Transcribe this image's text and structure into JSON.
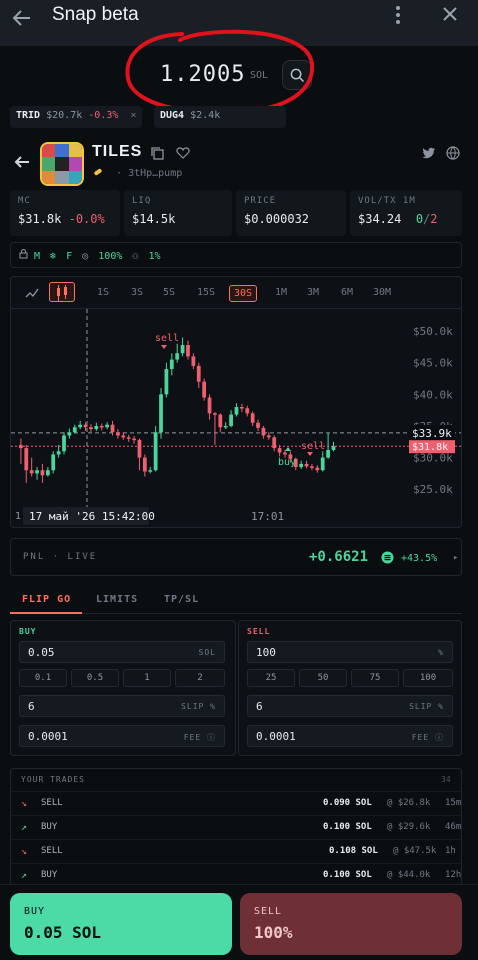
{
  "app": {
    "title": "Snap beta",
    "icons": [
      "back-arrow-icon",
      "kebab-menu-icon",
      "close-icon"
    ]
  },
  "balance": {
    "value": "1.2005",
    "unit": "SOL"
  },
  "ticker_chips": [
    {
      "symbol": "TRID",
      "mc": "$20.7k",
      "change": "-0.3%",
      "close": "×"
    },
    {
      "symbol": "DUG4",
      "mc": "$2.4k",
      "change": "",
      "close": ""
    }
  ],
  "token": {
    "name": "TILES",
    "address": "3tHp…pump",
    "separator": "·"
  },
  "stats": {
    "mc": {
      "label": "MC",
      "value": "$31.8k",
      "change": "-0.0%"
    },
    "liq": {
      "label": "LIQ",
      "value": "$14.5k"
    },
    "price": {
      "label": "PRICE",
      "value": "$0.000032"
    },
    "vol": {
      "label": "VOL/TX 1M",
      "value": "$34.24",
      "buys": "0",
      "slash": "/",
      "sells": "2"
    }
  },
  "flags": {
    "m": "M",
    "f": "F",
    "pct1": "100%",
    "pct2": "1%"
  },
  "chart": {
    "timeframes": [
      "1S",
      "3S",
      "5S",
      "15S",
      "30S",
      "1M",
      "3M",
      "6M",
      "30M"
    ],
    "active_timeframe": "30S",
    "crosshair_date": "17 май '26",
    "crosshair_time": "15:42:00",
    "axis_start_label": "1",
    "time_label": "17:01",
    "markers": {
      "sell1": "sell",
      "sell2": "sell",
      "buy": "buy"
    },
    "price_tags": {
      "high": "$33.9k",
      "current": "$31.8k"
    }
  },
  "chart_data": {
    "type": "candlestick",
    "yticks": [
      "$50.0k",
      "$45.0k",
      "$40.0k",
      "$35.0k",
      "$30.0k",
      "$25.0k"
    ],
    "ytick_values": [
      50.0,
      45.0,
      40.0,
      35.0,
      30.0,
      25.0
    ],
    "ylim": [
      22.5,
      53.5
    ],
    "reference_lines": [
      33.9,
      31.8
    ],
    "candles": [
      [
        32,
        31.5,
        33,
        29
      ],
      [
        31.5,
        28,
        32,
        26
      ],
      [
        28,
        27.5,
        30,
        27
      ],
      [
        27.5,
        28,
        28.5,
        26.5
      ],
      [
        28,
        27.2,
        29,
        26
      ],
      [
        27.2,
        28,
        28.5,
        27
      ],
      [
        28,
        30.5,
        31,
        27.5
      ],
      [
        30.5,
        31,
        32,
        30
      ],
      [
        31,
        33.5,
        34,
        30.5
      ],
      [
        33.5,
        34,
        34.6,
        33
      ],
      [
        34,
        34.8,
        35.2,
        33.8
      ],
      [
        34.8,
        35.2,
        35.8,
        34.5
      ],
      [
        35.2,
        34.8,
        35.6,
        34.2
      ],
      [
        34.8,
        34.5,
        35.3,
        34
      ],
      [
        34.5,
        35,
        35.5,
        34.2
      ],
      [
        35,
        34.8,
        35.4,
        34.3
      ],
      [
        34.8,
        35.2,
        35.6,
        34.5
      ],
      [
        35.2,
        34,
        35.8,
        33.5
      ],
      [
        34,
        33.5,
        34.5,
        33
      ],
      [
        33.5,
        33.2,
        34,
        32.8
      ],
      [
        33.2,
        33,
        33.6,
        32.5
      ],
      [
        33,
        32.8,
        33.4,
        32.2
      ],
      [
        32.8,
        30,
        33,
        28
      ],
      [
        30,
        27.8,
        30.5,
        27
      ],
      [
        27.8,
        28,
        28.5,
        27.5
      ],
      [
        28,
        34,
        35,
        27.8
      ],
      [
        34,
        40,
        41,
        33
      ],
      [
        40,
        44,
        45,
        39.5
      ],
      [
        44,
        45.5,
        46.5,
        43
      ],
      [
        45.5,
        46.5,
        48,
        45
      ],
      [
        46.5,
        47.8,
        49,
        46
      ],
      [
        47.8,
        46,
        48.5,
        45.5
      ],
      [
        46,
        44.5,
        46.5,
        44
      ],
      [
        44.5,
        42,
        45,
        41
      ],
      [
        42,
        39.5,
        42.5,
        39
      ],
      [
        39.5,
        37,
        40,
        36
      ],
      [
        37,
        36.8,
        37.2,
        32
      ],
      [
        36.8,
        34.8,
        37,
        34
      ],
      [
        34.8,
        35,
        35.6,
        34.5
      ],
      [
        35,
        36.8,
        37.5,
        34.8
      ],
      [
        36.8,
        38,
        38.6,
        36.5
      ],
      [
        38,
        37.8,
        38.5,
        37.2
      ],
      [
        37.8,
        37,
        38.2,
        36.5
      ],
      [
        37,
        35.5,
        37.3,
        35
      ],
      [
        35.5,
        34.7,
        36,
        34.2
      ],
      [
        34.7,
        33.5,
        35,
        33
      ],
      [
        33.5,
        33.2,
        34,
        32.8
      ],
      [
        33.2,
        31.5,
        33.5,
        31
      ],
      [
        31.5,
        30.8,
        32,
        30.2
      ],
      [
        30.8,
        30.5,
        31.2,
        30
      ],
      [
        30.5,
        29.8,
        31,
        29.2
      ],
      [
        29.8,
        28.5,
        30,
        28
      ],
      [
        28.5,
        29,
        29.5,
        28.2
      ],
      [
        29,
        28.6,
        29.5,
        28.3
      ],
      [
        28.6,
        28.4,
        29,
        28
      ],
      [
        28.4,
        28,
        28.8,
        27.6
      ],
      [
        28,
        30,
        31,
        27.8
      ],
      [
        30,
        31.2,
        33.9,
        29.8
      ],
      [
        31.2,
        31.8,
        32.5,
        31
      ]
    ]
  },
  "pnl": {
    "label": "PNL",
    "dot": "·",
    "status": "LIVE",
    "value": "+0.6621",
    "percent": "+43.5%",
    "arrow": "▸"
  },
  "trade_tabs": [
    "FLIP GO",
    "LIMITS",
    "TP/SL"
  ],
  "buy_panel": {
    "title": "BUY",
    "amount": "0.05",
    "amount_unit": "SOL",
    "presets": [
      "0.1",
      "0.5",
      "1",
      "2"
    ],
    "slippage": "6",
    "slippage_unit": "SLIP %",
    "fee": "0.0001",
    "fee_unit": "FEE"
  },
  "sell_panel": {
    "title": "SELL",
    "amount": "100",
    "amount_unit": "%",
    "presets": [
      "25",
      "50",
      "75",
      "100"
    ],
    "slippage": "6",
    "slippage_unit": "SLIP %",
    "fee": "0.0001",
    "fee_unit": "FEE"
  },
  "trades": {
    "header": "YOUR TRADES",
    "count": "34",
    "rows": [
      {
        "side": "SELL",
        "amount": "0.090 SOL",
        "at": "@ $26.8k",
        "time": "15m"
      },
      {
        "side": "BUY",
        "amount": "0.100 SOL",
        "at": "@ $29.6k",
        "time": "46m"
      },
      {
        "side": "SELL",
        "amount": "0.108 SOL",
        "at": "@ $47.5k",
        "time": "1h"
      },
      {
        "side": "BUY",
        "amount": "0.100 SOL",
        "at": "@ $44.0k",
        "time": "12h"
      }
    ]
  },
  "actions": {
    "buy_label": "BUY",
    "buy_value": "0.05 SOL",
    "sell_label": "SELL",
    "sell_value": "100%"
  },
  "colors": {
    "up": "#4cd59b",
    "down": "#ef5f6e",
    "accent": "#ff6f5e",
    "annotation": "#e0121b"
  }
}
